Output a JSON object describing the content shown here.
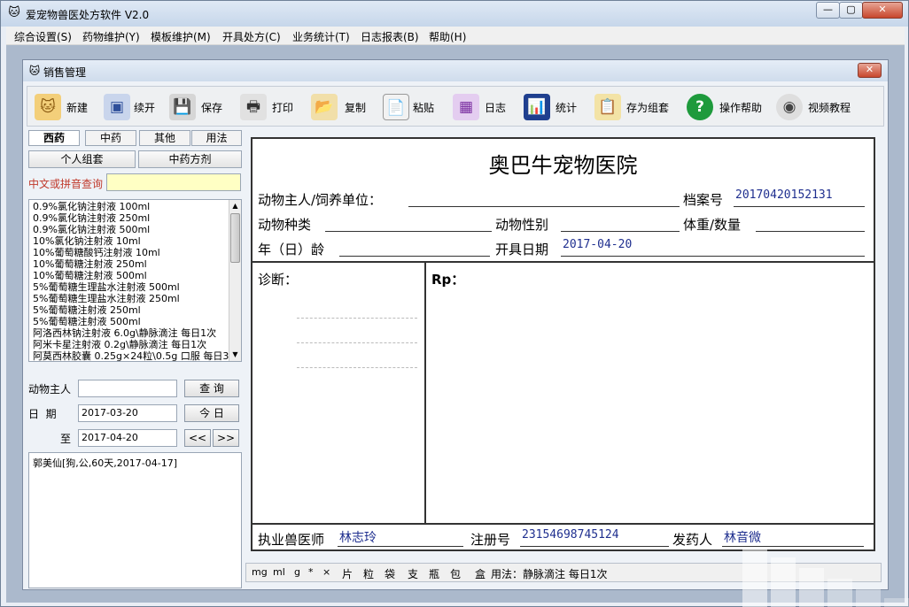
{
  "app": {
    "title": "爱宠物兽医处方软件 V2.0"
  },
  "menu": [
    "综合设置(S)",
    "药物维护(Y)",
    "模板维护(M)",
    "开具处方(C)",
    "业务统计(T)",
    "日志报表(B)",
    "帮助(H)"
  ],
  "child_window": {
    "title": "销售管理"
  },
  "toolbar": [
    {
      "label": "新建",
      "icon": "cat-face-icon",
      "color": "#e8a93a"
    },
    {
      "label": "续开",
      "icon": "window-icon",
      "color": "#5573b8"
    },
    {
      "label": "保存",
      "icon": "floppy-disk-icon",
      "color": "#444444"
    },
    {
      "label": "打印",
      "icon": "printer-icon",
      "color": "#777777"
    },
    {
      "label": "复制",
      "icon": "folder-icon",
      "color": "#c9a34a"
    },
    {
      "label": "粘贴",
      "icon": "paste-icon",
      "color": "#888888"
    },
    {
      "label": "日志",
      "icon": "calendar-icon",
      "color": "#9b4fc0"
    },
    {
      "label": "统计",
      "icon": "chart-icon",
      "color": "#2b4ea0"
    },
    {
      "label": "存为组套",
      "icon": "clipboard-icon",
      "color": "#d1b24a"
    },
    {
      "label": "操作帮助",
      "icon": "help-icon",
      "color": "#1e9a3c"
    },
    {
      "label": "视频教程",
      "icon": "cd-icon",
      "color": "#8a8a8a"
    }
  ],
  "left": {
    "tabs": [
      "西药",
      "中药",
      "其他",
      "用法"
    ],
    "buttons": [
      "个人组套",
      "中药方剂"
    ],
    "search_label": "中文或拼音查询",
    "search_value": "",
    "drugs": [
      "0.9%氯化钠注射液 100ml",
      "0.9%氯化钠注射液 250ml",
      "0.9%氯化钠注射液 500ml",
      "10%氯化钠注射液 10ml",
      "10%葡萄糖酸钙注射液 10ml",
      "10%葡萄糖注射液 250ml",
      "10%葡萄糖注射液 500ml",
      "5%葡萄糖生理盐水注射液 500ml",
      "5%葡萄糖生理盐水注射液 250ml",
      "5%葡萄糖注射液 250ml",
      "5%葡萄糖注射液 500ml",
      "阿洛西林钠注射液 6.0g\\静脉滴注 每日1次",
      "阿米卡星注射液 0.2g\\静脉滴注 每日1次",
      "阿莫西林胶囊 0.25g×24粒\\0.5g 口服 每日3"
    ],
    "owner_label": "动物主人",
    "owner_value": "",
    "query_button": "查 询",
    "date_label": "日  期",
    "date_from": "2017-03-20",
    "today_button": "今 日",
    "to_label": "至",
    "date_to": "2017-04-20",
    "prev_button": "<<",
    "next_button": ">>",
    "results": [
      "郭美仙[狗,公,60天,2017-04-17]"
    ]
  },
  "form": {
    "hospital": "奥巴牛宠物医院",
    "owner_label": "动物主人/饲养单位：",
    "owner_value": "",
    "record_label": "档案号",
    "record_value": "20170420152131",
    "species_label": "动物种类",
    "species_value": "",
    "sex_label": "动物性别",
    "sex_value": "",
    "weight_label": "体重/数量",
    "weight_value": "",
    "age_label": "年（日）龄",
    "age_value": "",
    "date_label": "开具日期",
    "date_value": "2017-04-20",
    "diagnosis_label": "诊断：",
    "rp_label": "Rp：",
    "vet_label": "执业兽医师",
    "vet_value": "林志玲",
    "reg_label": "注册号",
    "reg_value": "23154698745124",
    "dispenser_label": "发药人",
    "dispenser_value": "林音微"
  },
  "units": [
    "mg",
    "ml",
    "g",
    "*",
    "×",
    "片",
    "粒",
    "袋",
    "支",
    "瓶",
    "包",
    "盒"
  ],
  "usage_text": "用法：静脉滴注 每日1次"
}
